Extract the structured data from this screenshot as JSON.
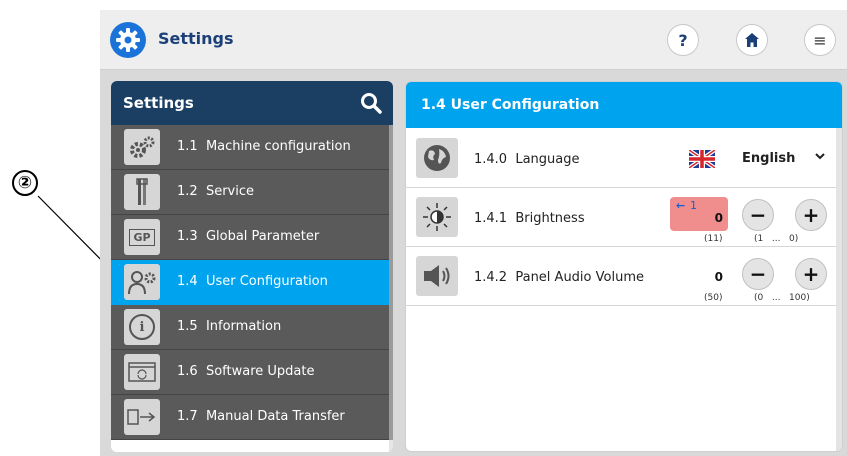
{
  "callout": {
    "number": "②"
  },
  "app": {
    "title": "Settings",
    "help_label": "?",
    "home_label": "⌂",
    "menu_label": "≡"
  },
  "left_panel": {
    "title": "Settings",
    "items": [
      {
        "number": "1.1",
        "label": "Machine configuration",
        "icon": "gears-icon",
        "active": false
      },
      {
        "number": "1.2",
        "label": "Service",
        "icon": "tools-icon",
        "active": false
      },
      {
        "number": "1.3",
        "label": "Global Parameter",
        "icon": "gp-icon",
        "icon_text": "GP",
        "active": false
      },
      {
        "number": "1.4",
        "label": "User Configuration",
        "icon": "user-gear-icon",
        "active": true
      },
      {
        "number": "1.5",
        "label": "Information",
        "icon": "info-icon",
        "icon_text": "i",
        "active": false
      },
      {
        "number": "1.6",
        "label": "Software Update",
        "icon": "software-update-icon",
        "active": false
      },
      {
        "number": "1.7",
        "label": "Manual Data Transfer",
        "icon": "data-transfer-icon",
        "active": false
      }
    ]
  },
  "right_panel": {
    "title": "1.4 User Configuration",
    "language": {
      "number": "1.4.0",
      "label": "Language",
      "value": "English",
      "icon": "globe-icon"
    },
    "brightness": {
      "number": "1.4.1",
      "label": "Brightness",
      "previous_value": "1",
      "value": "0",
      "default": "(11)",
      "range_min": "(1",
      "range_sep": "...",
      "range_max": "0)",
      "changed_color": "#f08d8d",
      "icon": "sun-icon"
    },
    "volume": {
      "number": "1.4.2",
      "label": "Panel Audio Volume",
      "value": "0",
      "default": "(50)",
      "range_min": "(0",
      "range_sep": "...",
      "range_max": "100)",
      "icon": "speaker-icon"
    },
    "minus_label": "−",
    "plus_label": "+"
  },
  "colors": {
    "accent": "#00a3ee",
    "header_dark": "#1b3f63",
    "nav_bg": "#5a5a5a",
    "brand": "#1a73d9"
  }
}
